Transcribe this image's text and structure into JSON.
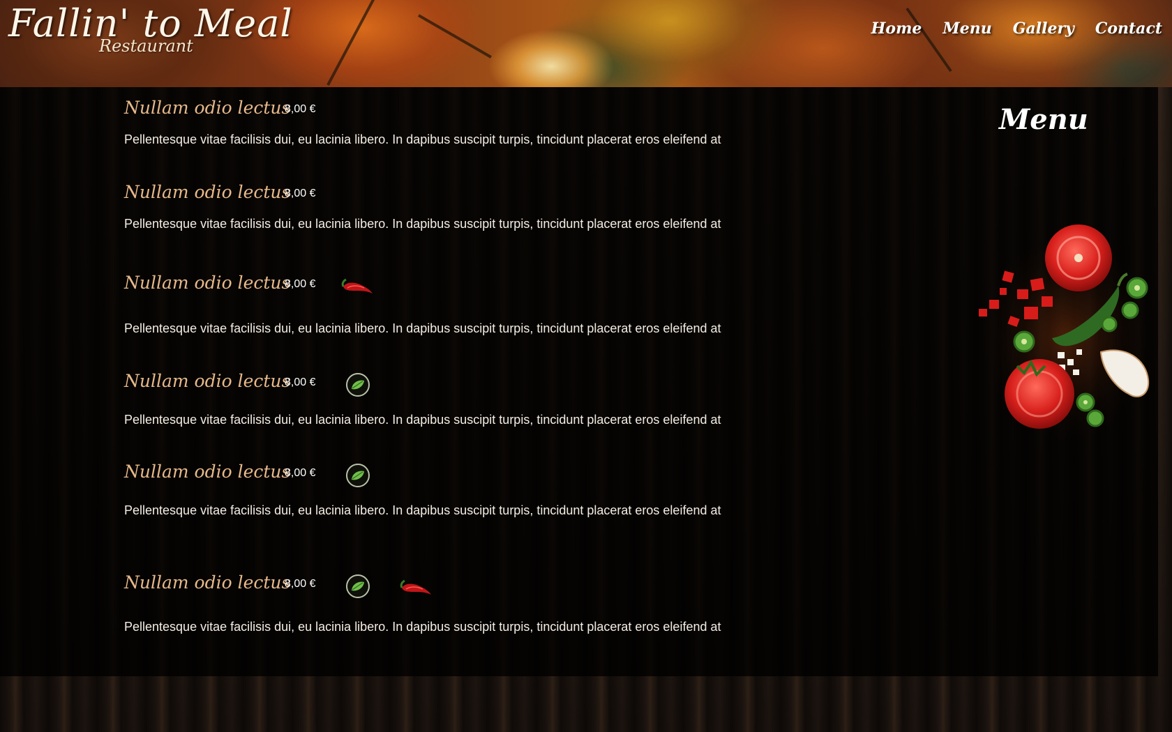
{
  "header": {
    "logo_title": "Fallin' to Meal",
    "logo_subtitle": "Restaurant",
    "nav": [
      "Home",
      "Menu",
      "Gallery",
      "Contact"
    ]
  },
  "menu_heading": "Menu",
  "items": [
    {
      "name": "Nullam odio lectus",
      "price": "8,00 €",
      "description": "Pellentesque vitae facilisis dui, eu lacinia libero. In dapibus suscipit turpis, tincidunt placerat eros eleifend at",
      "icons": []
    },
    {
      "name": "Nullam odio lectus",
      "price": "8,00 €",
      "description": "Pellentesque vitae facilisis dui, eu lacinia libero. In dapibus suscipit turpis, tincidunt placerat eros eleifend at",
      "icons": []
    },
    {
      "name": "Nullam odio lectus",
      "price": "8,00 €",
      "description": "Pellentesque vitae facilisis dui, eu lacinia libero. In dapibus suscipit turpis, tincidunt placerat eros eleifend at",
      "icons": [
        "chili-pepper-icon"
      ]
    },
    {
      "name": "Nullam odio lectus",
      "price": "8,00 €",
      "description": "Pellentesque vitae facilisis dui, eu lacinia libero. In dapibus suscipit turpis, tincidunt placerat eros eleifend at",
      "icons": [
        "leaf-icon"
      ]
    },
    {
      "name": "Nullam odio lectus",
      "price": "8,00 €",
      "description": "Pellentesque vitae facilisis dui, eu lacinia libero. In dapibus suscipit turpis, tincidunt placerat eros eleifend at",
      "icons": [
        "leaf-icon"
      ]
    },
    {
      "name": "Nullam odio lectus",
      "price": "8,00 €",
      "description": "Pellentesque vitae facilisis dui, eu lacinia libero. In dapibus suscipit turpis, tincidunt placerat eros eleifend at",
      "icons": [
        "leaf-icon",
        "chili-pepper-icon"
      ]
    }
  ],
  "colors": {
    "item_name": "#e7b98a",
    "text": "#f4ede4",
    "panel": "#000000"
  }
}
